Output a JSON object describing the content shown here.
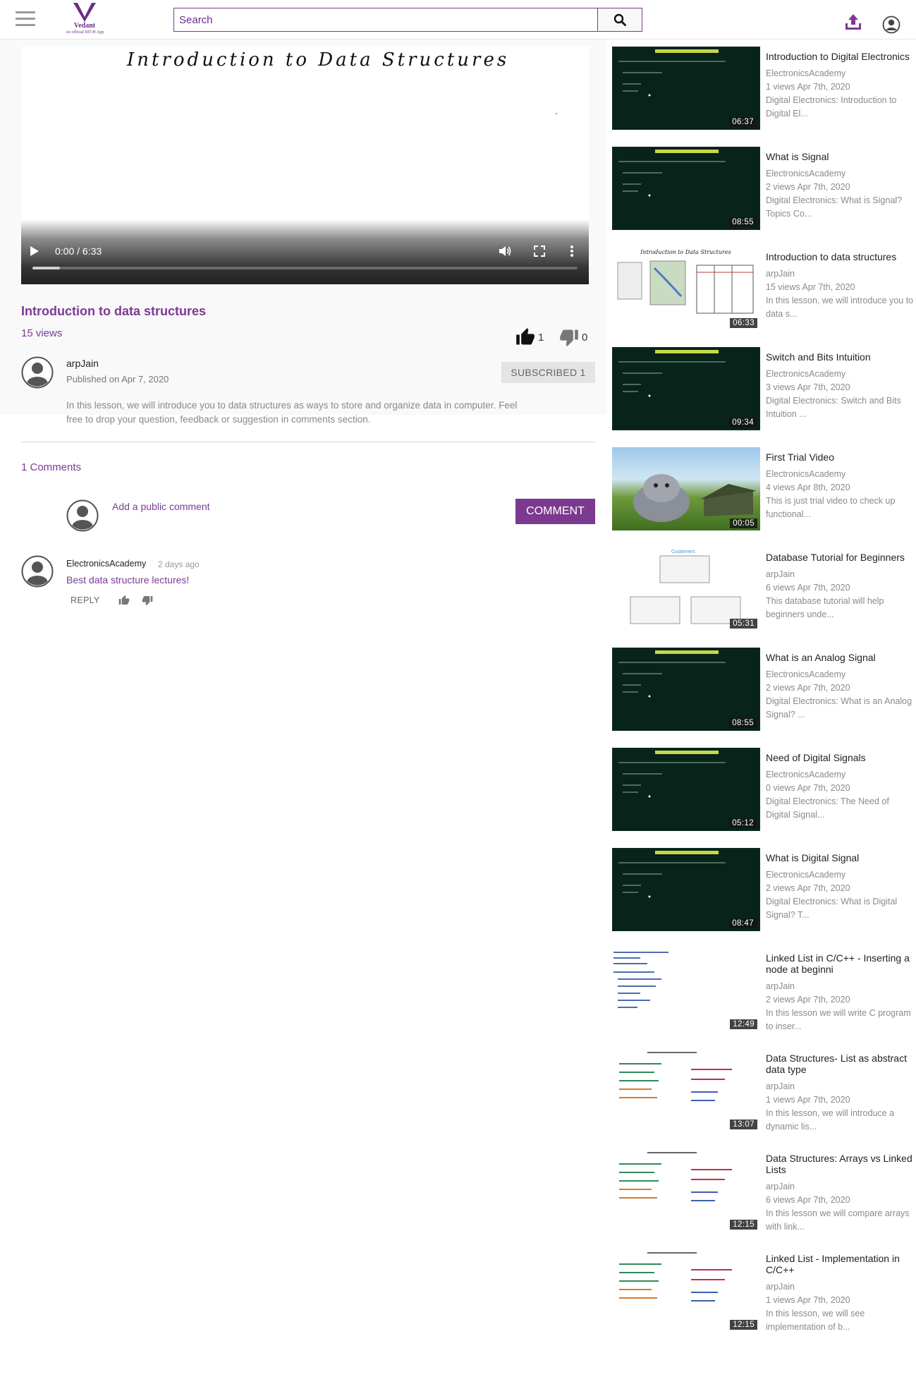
{
  "header": {
    "logo_name": "Vedant",
    "logo_tagline": "An official IIIT-H App",
    "search_placeholder": "Search",
    "accent": "#7b3a8f"
  },
  "video": {
    "handwritten_title": "Introduction to Data Structures",
    "current_time": "0:00",
    "duration": "6:33",
    "time_display": "0:00 / 6:33",
    "progress_fraction": 0.05,
    "title": "Introduction to data structures",
    "views": "15 views",
    "likes": "1",
    "dislikes": "0",
    "channel": "arpJain",
    "published": "Published on Apr 7, 2020",
    "subscribe_label": "SUBSCRIBED 1",
    "description": "In this lesson, we will introduce you to data structures as ways to store and organize data in computer. Feel free to drop your question, feedback or suggestion in comments section."
  },
  "comments": {
    "count_label": "1 Comments",
    "add_placeholder": "Add a public comment",
    "submit_label": "COMMENT",
    "items": [
      {
        "author": "ElectronicsAcademy",
        "time": "2 days ago",
        "text": "Best data structure lectures!",
        "reply_label": "REPLY"
      }
    ]
  },
  "related": [
    {
      "title": "Introduction to Digital Electronics",
      "channel": "ElectronicsAcademy",
      "meta": "1 views Apr 7th, 2020",
      "desc": "Digital Electronics: Introduction to Digital El...",
      "duration": "06:37",
      "thumb": "dark-board"
    },
    {
      "title": "What is Signal",
      "channel": "ElectronicsAcademy",
      "meta": "2 views Apr 7th, 2020",
      "desc": "Digital Electronics: What is Signal? Topics Co...",
      "duration": "08:55",
      "thumb": "dark-board"
    },
    {
      "title": "Introduction to data structures",
      "channel": "arpJain",
      "meta": "15 views Apr 7th, 2020",
      "desc": "In this lesson, we will introduce you to data s...",
      "duration": "06:33",
      "thumb": "whiteboard"
    },
    {
      "title": "Switch and Bits Intuition",
      "channel": "ElectronicsAcademy",
      "meta": "3 views Apr 7th, 2020",
      "desc": "Digital Electronics: Switch and Bits Intuition ...",
      "duration": "09:34",
      "thumb": "dark-board"
    },
    {
      "title": "First Trial Video",
      "channel": "ElectronicsAcademy",
      "meta": "4 views Apr 8th, 2020",
      "desc": "This is just trial video to check up functional...",
      "duration": "00:05",
      "thumb": "animation"
    },
    {
      "title": "Database Tutorial for Beginners",
      "channel": "arpJain",
      "meta": "6 views Apr 7th, 2020",
      "desc": "This database tutorial will help beginners unde...",
      "duration": "05:31",
      "thumb": "tables"
    },
    {
      "title": "What is an Analog Signal",
      "channel": "ElectronicsAcademy",
      "meta": "2 views Apr 7th, 2020",
      "desc": "Digital Electronics: What is an Analog Signal? ...",
      "duration": "08:55",
      "thumb": "dark-board"
    },
    {
      "title": "Need of Digital Signals",
      "channel": "ElectronicsAcademy",
      "meta": "0 views Apr 7th, 2020",
      "desc": "Digital Electronics: The Need of Digital Signal...",
      "duration": "05:12",
      "thumb": "dark-board"
    },
    {
      "title": "What is Digital Signal",
      "channel": "ElectronicsAcademy",
      "meta": "2 views Apr 7th, 2020",
      "desc": "Digital Electronics: What is Digital Signal? T...",
      "duration": "08:47",
      "thumb": "dark-board"
    },
    {
      "title": "Linked List in C/C++ - Inserting a node at beginni",
      "channel": "arpJain",
      "meta": "2 views Apr 7th, 2020",
      "desc": "In this lesson we will write C program to inser...",
      "duration": "12:49",
      "thumb": "code"
    },
    {
      "title": "Data Structures- List as abstract data type",
      "channel": "arpJain",
      "meta": "1 views Apr 7th, 2020",
      "desc": "In this lesson, we will introduce a dynamic lis...",
      "duration": "13:07",
      "thumb": "notes"
    },
    {
      "title": "Data Structures: Arrays vs Linked Lists",
      "channel": "arpJain",
      "meta": "6 views Apr 7th, 2020",
      "desc": "In this lesson we will compare arrays with link...",
      "duration": "12:15",
      "thumb": "notes"
    },
    {
      "title": "Linked List - Implementation in C/C++",
      "channel": "arpJain",
      "meta": "1 views Apr 7th, 2020",
      "desc": "In this lesson, we will see implementation of b...",
      "duration": "12:15",
      "thumb": "notes"
    }
  ]
}
